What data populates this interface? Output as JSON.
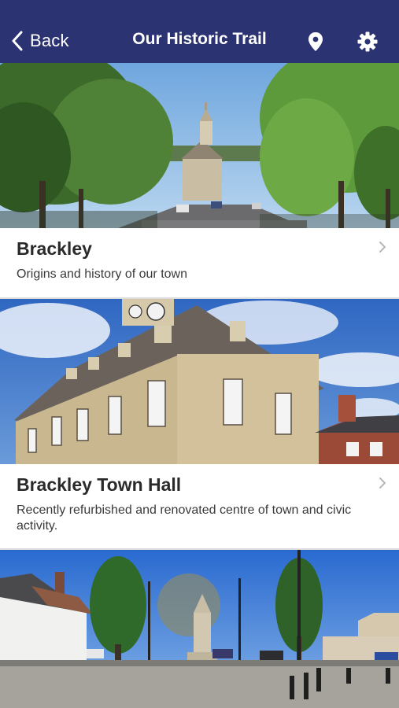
{
  "nav": {
    "back_label": "Back",
    "title": "Our Historic Trail",
    "background": "#2c3372",
    "icons": [
      "chevron-left-icon",
      "map-pin-icon",
      "gear-icon"
    ]
  },
  "items": [
    {
      "title": "Brackley",
      "subtitle": "Origins and history of our town"
    },
    {
      "title": "Brackley Town Hall",
      "subtitle": "Recently refurbished and renovated centre of town and civic activity."
    }
  ]
}
